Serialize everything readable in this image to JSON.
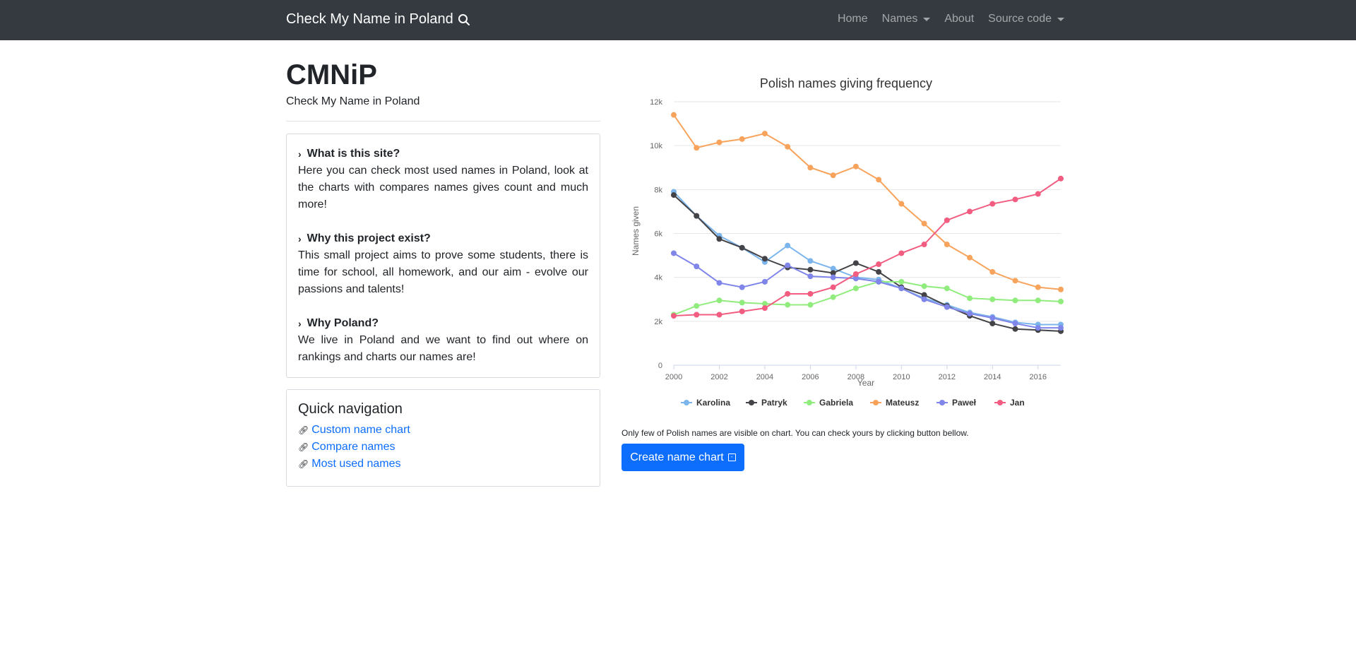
{
  "navbar": {
    "brand": "Check My Name in Poland",
    "links": [
      {
        "label": "Home"
      },
      {
        "label": "Names"
      },
      {
        "label": "About"
      },
      {
        "label": "Source code"
      }
    ]
  },
  "header": {
    "title": "CMNiP",
    "subtitle": "Check My Name in Poland"
  },
  "info": [
    {
      "q": "What is this site?",
      "a": "Here you can check most used names in Poland, look at the charts with compares names gives count and much more!"
    },
    {
      "q": "Why this project exist?",
      "a": "This small project aims to prove some students, there is time for school, all homework, and our aim - evolve our passions and talents!"
    },
    {
      "q": "Why Poland?",
      "a": "We live in Poland and we want to find out where on rankings and charts our names are!"
    }
  ],
  "quick_nav": {
    "title": "Quick navigation",
    "links": [
      "Custom name chart",
      "Compare names",
      "Most used names"
    ]
  },
  "chart_note": "Only few of Polish names are visible on chart. You can check yours by clicking button bellow.",
  "create_button": "Create name chart",
  "chart_data": {
    "type": "line",
    "title": "Polish names giving frequency",
    "xlabel": "Year",
    "ylabel": "Names given",
    "x": [
      2000,
      2001,
      2002,
      2003,
      2004,
      2005,
      2006,
      2007,
      2008,
      2009,
      2010,
      2011,
      2012,
      2013,
      2014,
      2015,
      2016,
      2017
    ],
    "xticks": [
      "2000",
      "2002",
      "2004",
      "2006",
      "2008",
      "2010",
      "2012",
      "2014",
      "2016"
    ],
    "yticks": [
      "0",
      "2k",
      "4k",
      "6k",
      "8k",
      "10k",
      "12k"
    ],
    "ylim": [
      0,
      12000
    ],
    "grid": true,
    "legend": "bottom",
    "series": [
      {
        "name": "Karolina",
        "color": "#7cb5ec",
        "values": [
          7900,
          6800,
          5900,
          5350,
          4700,
          5450,
          4750,
          4400,
          4000,
          3900,
          3500,
          3050,
          2750,
          2400,
          2200,
          1950,
          1850,
          1850
        ]
      },
      {
        "name": "Patryk",
        "color": "#434348",
        "values": [
          7750,
          6800,
          5750,
          5350,
          4850,
          4450,
          4350,
          4200,
          4650,
          4250,
          3550,
          3200,
          2700,
          2250,
          1900,
          1650,
          1600,
          1550
        ]
      },
      {
        "name": "Gabriela",
        "color": "#90ed7d",
        "values": [
          2300,
          2700,
          2950,
          2850,
          2800,
          2750,
          2750,
          3100,
          3500,
          3800,
          3800,
          3600,
          3500,
          3050,
          3000,
          2950,
          2950,
          2900
        ]
      },
      {
        "name": "Mateusz",
        "color": "#f7a35c",
        "values": [
          11400,
          9900,
          10150,
          10300,
          10550,
          9950,
          9000,
          8650,
          9050,
          8450,
          7350,
          6450,
          5500,
          4900,
          4250,
          3850,
          3550,
          3450
        ]
      },
      {
        "name": "Paweł",
        "color": "#8085e9",
        "values": [
          5100,
          4500,
          3750,
          3550,
          3800,
          4550,
          4050,
          4000,
          3950,
          3800,
          3500,
          3000,
          2650,
          2350,
          2150,
          1900,
          1700,
          1700
        ]
      },
      {
        "name": "Jan",
        "color": "#f15c80",
        "values": [
          2250,
          2300,
          2300,
          2450,
          2600,
          3250,
          3250,
          3550,
          4150,
          4600,
          5100,
          5500,
          6600,
          7000,
          7350,
          7550,
          7800,
          8500
        ]
      }
    ]
  }
}
